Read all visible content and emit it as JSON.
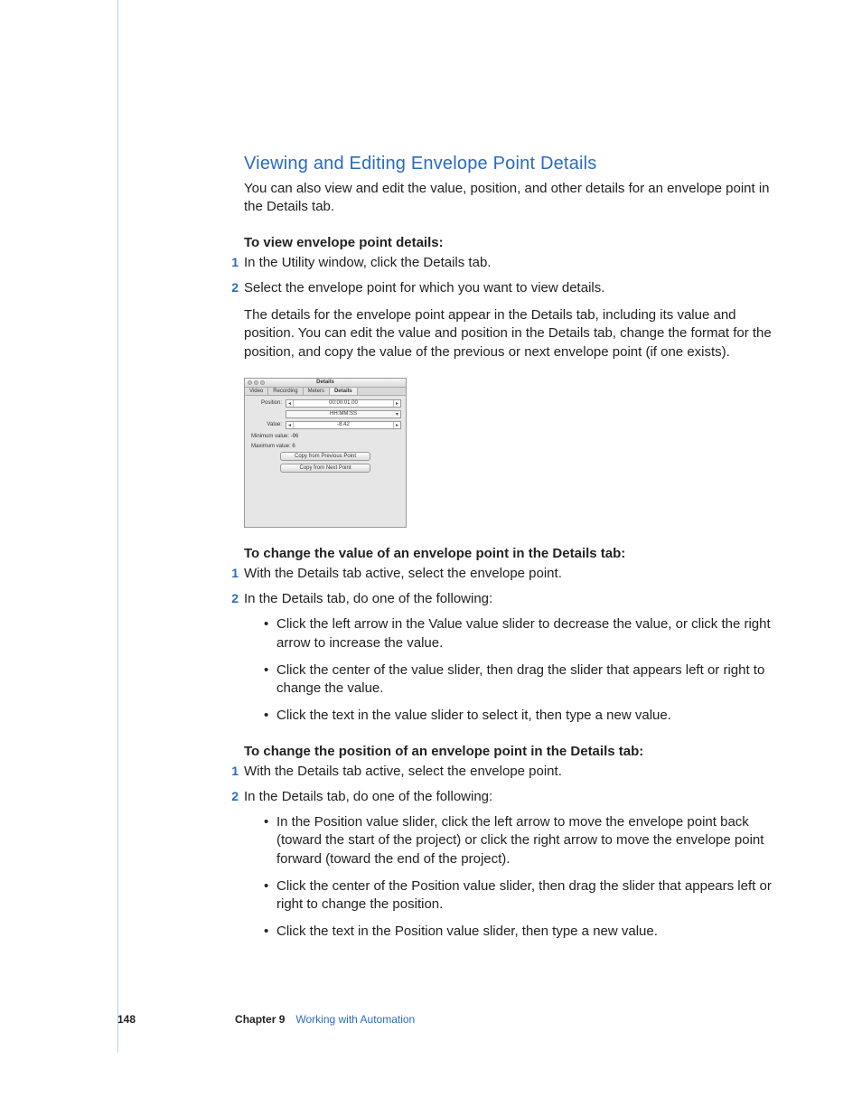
{
  "heading": "Viewing and Editing Envelope Point Details",
  "intro": "You can also view and edit the value, position, and other details for an envelope point in the Details tab.",
  "task1": {
    "title": "To view envelope point details:",
    "steps": [
      "In the Utility window, click the Details tab.",
      "Select the envelope point for which you want to view details."
    ],
    "after": "The details for the envelope point appear in the Details tab, including its value and position. You can edit the value and position in the Details tab, change the format for the position, and copy the value of the previous or next envelope point (if one exists)."
  },
  "figure": {
    "window_title": "Details",
    "tabs": [
      "Video",
      "Recording",
      "Meters",
      "Details"
    ],
    "active_tab": "Details",
    "position_label": "Position:",
    "position_value": "00:00:01.00",
    "format_value": "HH:MM:SS",
    "value_label": "Value:",
    "value_value": "-8.42",
    "min_label": "Minimum value:",
    "min_value": "-96",
    "max_label": "Maximum value:",
    "max_value": "6",
    "btn_prev": "Copy from Previous Point",
    "btn_next": "Copy from Next Point"
  },
  "task2": {
    "title": "To change the value of an envelope point in the Details tab:",
    "steps": [
      "With the Details tab active, select the envelope point.",
      "In the Details tab, do one of the following:"
    ],
    "bullets": [
      "Click the left arrow in the Value value slider to decrease the value, or click the right arrow to increase the value.",
      "Click the center of the value slider, then drag the slider that appears left or right to change the value.",
      "Click the text in the value slider to select it, then type a new value."
    ]
  },
  "task3": {
    "title": "To change the position of an envelope point in the Details tab:",
    "steps": [
      "With the Details tab active, select the envelope point.",
      "In the Details tab, do one of the following:"
    ],
    "bullets": [
      "In the Position value slider, click the left arrow to move the envelope point back (toward the start of the project) or click the right arrow to move the envelope point forward (toward the end of the project).",
      "Click the center of the Position value slider, then drag the slider that appears left or right to change the position.",
      "Click the text in the Position value slider, then type a new value."
    ]
  },
  "footer": {
    "page": "148",
    "chapter": "Chapter 9",
    "chapter_title": "Working with Automation"
  }
}
